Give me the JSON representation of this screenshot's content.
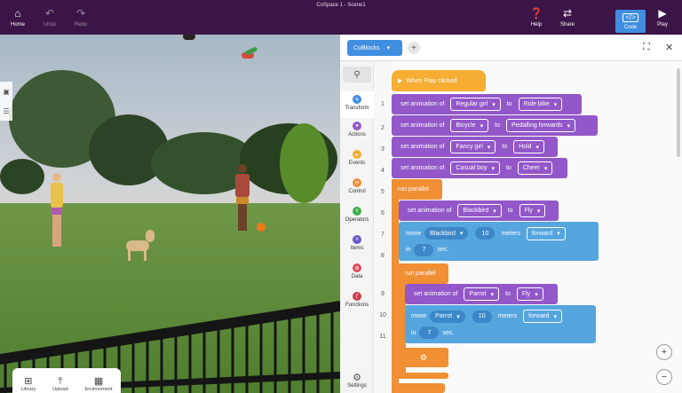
{
  "app": {
    "title": "CoSpace 1 - Scene1"
  },
  "topbar": {
    "home": "Home",
    "undo": "Undo",
    "redo": "Redo",
    "help": "Help",
    "share": "Share",
    "code": "Code",
    "play": "Play"
  },
  "scene_toolbar": {
    "library": "Library",
    "upload": "Upload",
    "environment": "Environment"
  },
  "tabs": {
    "active": "CoBlocks",
    "add": "+"
  },
  "categories": [
    "Transform",
    "Actions",
    "Events",
    "Control",
    "Operators",
    "Items",
    "Data",
    "Functions"
  ],
  "settings": "Settings",
  "line_numbers": [
    "1",
    "2",
    "3",
    "4",
    "5",
    "6",
    "7",
    "8",
    "9",
    "10",
    "11"
  ],
  "colors": {
    "purple": "#9357c9",
    "orange": "#f08f34",
    "blue": "#55a5df",
    "topbar": "#3b1547",
    "accent": "#3f8ee0"
  },
  "code": {
    "l1": {
      "text": "When Play clicked"
    },
    "l2": {
      "set": "set animation of",
      "obj": "Regular girl",
      "to": "to",
      "anim": "Ride bike"
    },
    "l3": {
      "set": "set animation of",
      "obj": "Bicycle",
      "to": "to",
      "anim": "Pedalling forwards"
    },
    "l4": {
      "set": "set animation of",
      "obj": "Fancy girl",
      "to": "to",
      "anim": "Hold"
    },
    "l5": {
      "set": "set animation of",
      "obj": "Casual boy",
      "to": "to",
      "anim": "Cheer"
    },
    "l6": {
      "text": "run parallel"
    },
    "l7": {
      "set": "set animation of",
      "obj": "Blackbird",
      "to": "to",
      "anim": "Fly"
    },
    "l8": {
      "move": "move",
      "obj": "Blackbird",
      "dist": "10",
      "unit": "meters",
      "dir": "forward",
      "in": "in",
      "time": "7",
      "sec": "sec."
    },
    "l9": {
      "text": "run parallel"
    },
    "l10": {
      "set": "set animation of",
      "obj": "Parrot",
      "to": "to",
      "anim": "Fly"
    },
    "l11": {
      "move": "move",
      "obj": "Parrot",
      "dist": "10",
      "unit": "meters",
      "dir": "forward",
      "in": "in",
      "time": "7",
      "sec": "sec."
    }
  }
}
